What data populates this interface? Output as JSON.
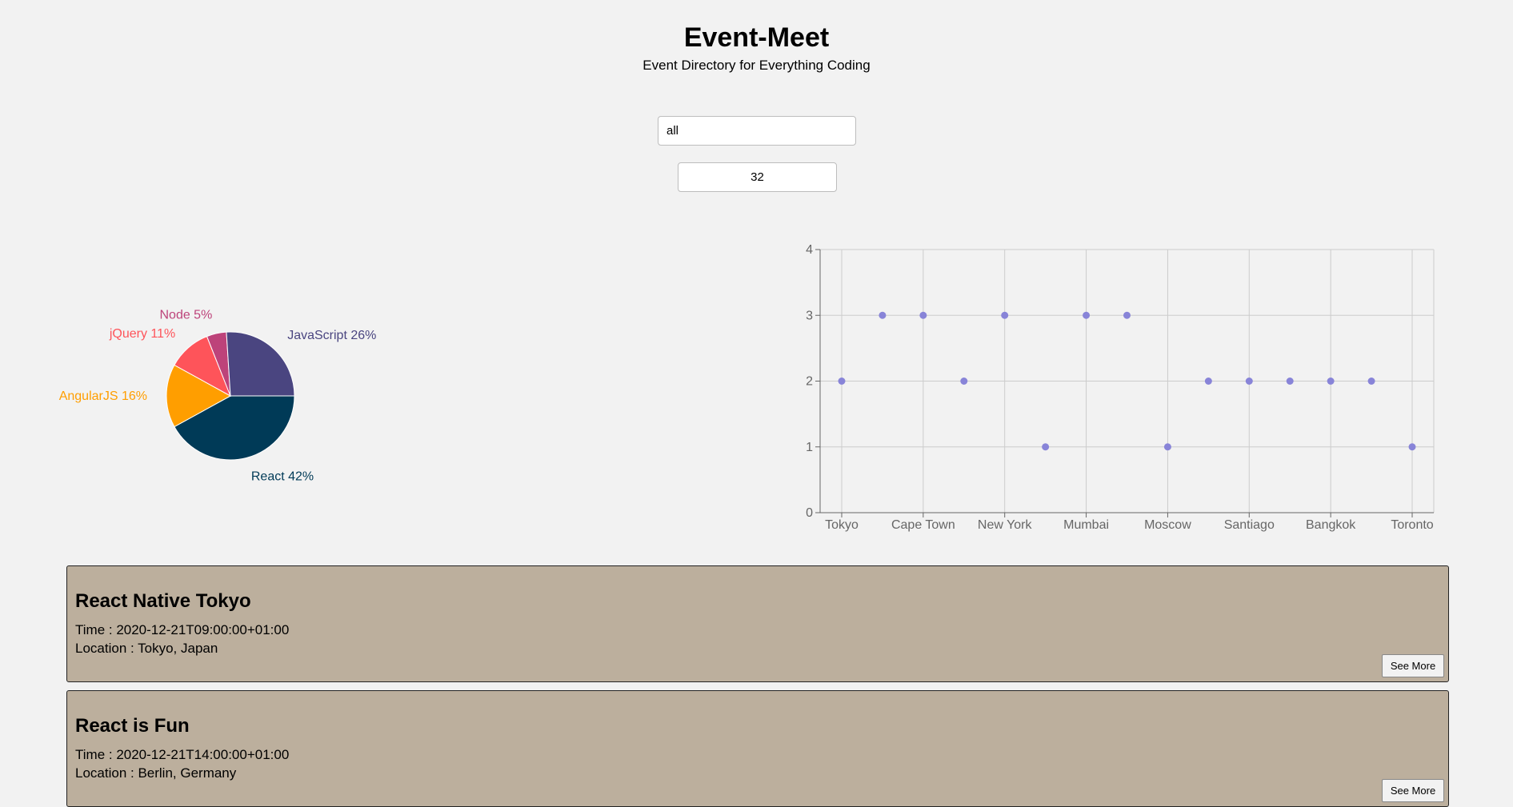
{
  "header": {
    "title": "Event-Meet",
    "subtitle": "Event Directory for Everything Coding"
  },
  "search": {
    "city_value": "all",
    "event_count_value": "32"
  },
  "colors": {
    "react": "#003a57",
    "javascript": "#4a4580",
    "node": "#bd437a",
    "jquery": "#fe545a",
    "angularjs": "#ff9e00",
    "scatter_point": "#8884d8",
    "card_background": "#bcaf9d"
  },
  "chart_data": [
    {
      "type": "pie",
      "slices": [
        {
          "name": "React",
          "label": "React 42%",
          "value": 42,
          "color": "#003a57"
        },
        {
          "name": "AngularJS",
          "label": "AngularJS 16%",
          "value": 16,
          "color": "#ff9e00"
        },
        {
          "name": "jQuery",
          "label": "jQuery 11%",
          "value": 11,
          "color": "#fe545a"
        },
        {
          "name": "Node",
          "label": "Node 5%",
          "value": 5,
          "color": "#bd437a"
        },
        {
          "name": "JavaScript",
          "label": "JavaScript 26%",
          "value": 26,
          "color": "#4a4580"
        }
      ]
    },
    {
      "type": "scatter",
      "x": [
        "Tokyo",
        "",
        "Cape Town",
        "",
        "New York",
        "",
        "Mumbai",
        "",
        "Moscow",
        "",
        "Santiago",
        "",
        "Bangkok",
        "",
        "Toronto"
      ],
      "tick_labels": [
        "Tokyo",
        "Cape Town",
        "New York",
        "Mumbai",
        "Moscow",
        "Santiago",
        "Bangkok",
        "Toronto"
      ],
      "y": [
        2,
        3,
        3,
        2,
        3,
        1,
        3,
        3,
        1,
        2,
        2,
        2,
        2,
        2,
        1
      ],
      "ylim": [
        0,
        4
      ],
      "yticks": [
        0,
        1,
        2,
        3,
        4
      ],
      "grid": true
    }
  ],
  "events": [
    {
      "name": "React Native Tokyo",
      "time": "Time : 2020-12-21T09:00:00+01:00",
      "location": "Location : Tokyo, Japan",
      "button_label": "See More"
    },
    {
      "name": "React is Fun",
      "time": "Time : 2020-12-21T14:00:00+01:00",
      "location": "Location : Berlin, Germany",
      "button_label": "See More"
    }
  ]
}
